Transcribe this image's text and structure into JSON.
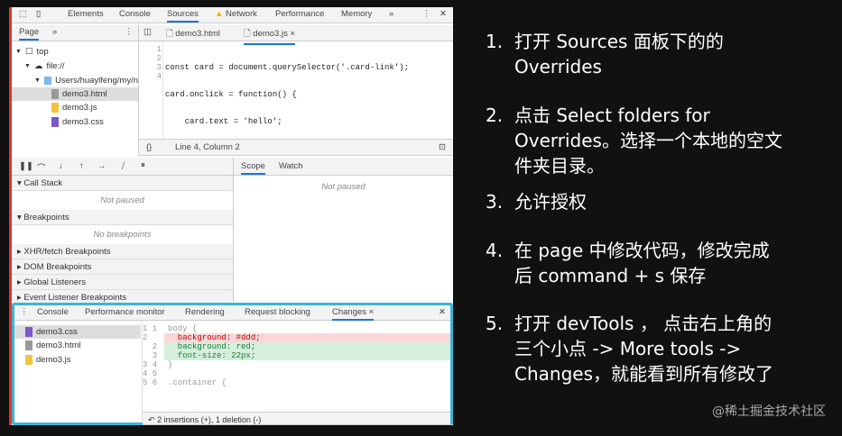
{
  "devtools": {
    "main_tabs": [
      "Elements",
      "Console",
      "Sources",
      "Network",
      "Performance",
      "Memory"
    ],
    "more": "»",
    "nav_tab": "Page",
    "tree": {
      "top": "top",
      "origin": "file://",
      "folder": "Users/huaylfeng/my/n",
      "files": [
        "demo3.html",
        "demo3.js",
        "demo3.css"
      ]
    },
    "editor_tabs": [
      "demo3.html",
      "demo3.js"
    ],
    "code": [
      "const card = document.querySelector('.card-link');",
      "card.onclick = function() {",
      "    card.text = 'hello';",
      "}"
    ],
    "status": "Line 4, Column 2",
    "sections": [
      {
        "label": "Call Stack",
        "empty": "Not paused"
      },
      {
        "label": "Breakpoints",
        "empty": "No breakpoints"
      },
      {
        "label": "XHR/fetch Breakpoints"
      },
      {
        "label": "DOM Breakpoints"
      },
      {
        "label": "Global Listeners"
      },
      {
        "label": "Event Listener Breakpoints"
      }
    ],
    "scope_tabs": [
      "Scope",
      "Watch"
    ],
    "scope_empty": "Not paused",
    "drawer_tabs": [
      "Console",
      "Performance monitor",
      "Rendering",
      "Request blocking",
      "Changes"
    ],
    "changes_files": [
      "demo3.css",
      "demo3.html",
      "demo3.js"
    ],
    "diff": [
      {
        "a": "1",
        "b": "1",
        "text": "body {",
        "type": "ctx"
      },
      {
        "a": "2",
        "b": "",
        "text": "  background: #ddd;",
        "type": "del"
      },
      {
        "a": "",
        "b": "2",
        "text": "  background: red;",
        "type": "add"
      },
      {
        "a": "",
        "b": "3",
        "text": "  font-size: 22px;",
        "type": "add"
      },
      {
        "a": "3",
        "b": "4",
        "text": "}",
        "type": "ctx"
      },
      {
        "a": "4",
        "b": "5",
        "text": "",
        "type": "ctx"
      },
      {
        "a": "5",
        "b": "6",
        "text": ".container {",
        "type": "ctx"
      }
    ],
    "diff_summary": "2 insertions (+), 1 deletion (-)"
  },
  "steps": [
    {
      "n": "1.",
      "lines": [
        "打开 Sources 面板下的的",
        "Overrides"
      ]
    },
    {
      "n": "2.",
      "lines": [
        "点击 Select folders for",
        "Overrides。选择一个本地的空文",
        "件夹目录。"
      ]
    },
    {
      "n": "3.",
      "lines": [
        "允许授权"
      ]
    },
    {
      "n": "4.",
      "lines": [
        "在 page 中修改代码，修改完成",
        "后 command + s 保存"
      ]
    },
    {
      "n": "5.",
      "lines": [
        "打开 devTools ， 点击右上角的",
        "三个小点 -> More tools ->",
        "Changes，就能看到所有修改了"
      ]
    }
  ],
  "watermark": "@稀土掘金技术社区"
}
